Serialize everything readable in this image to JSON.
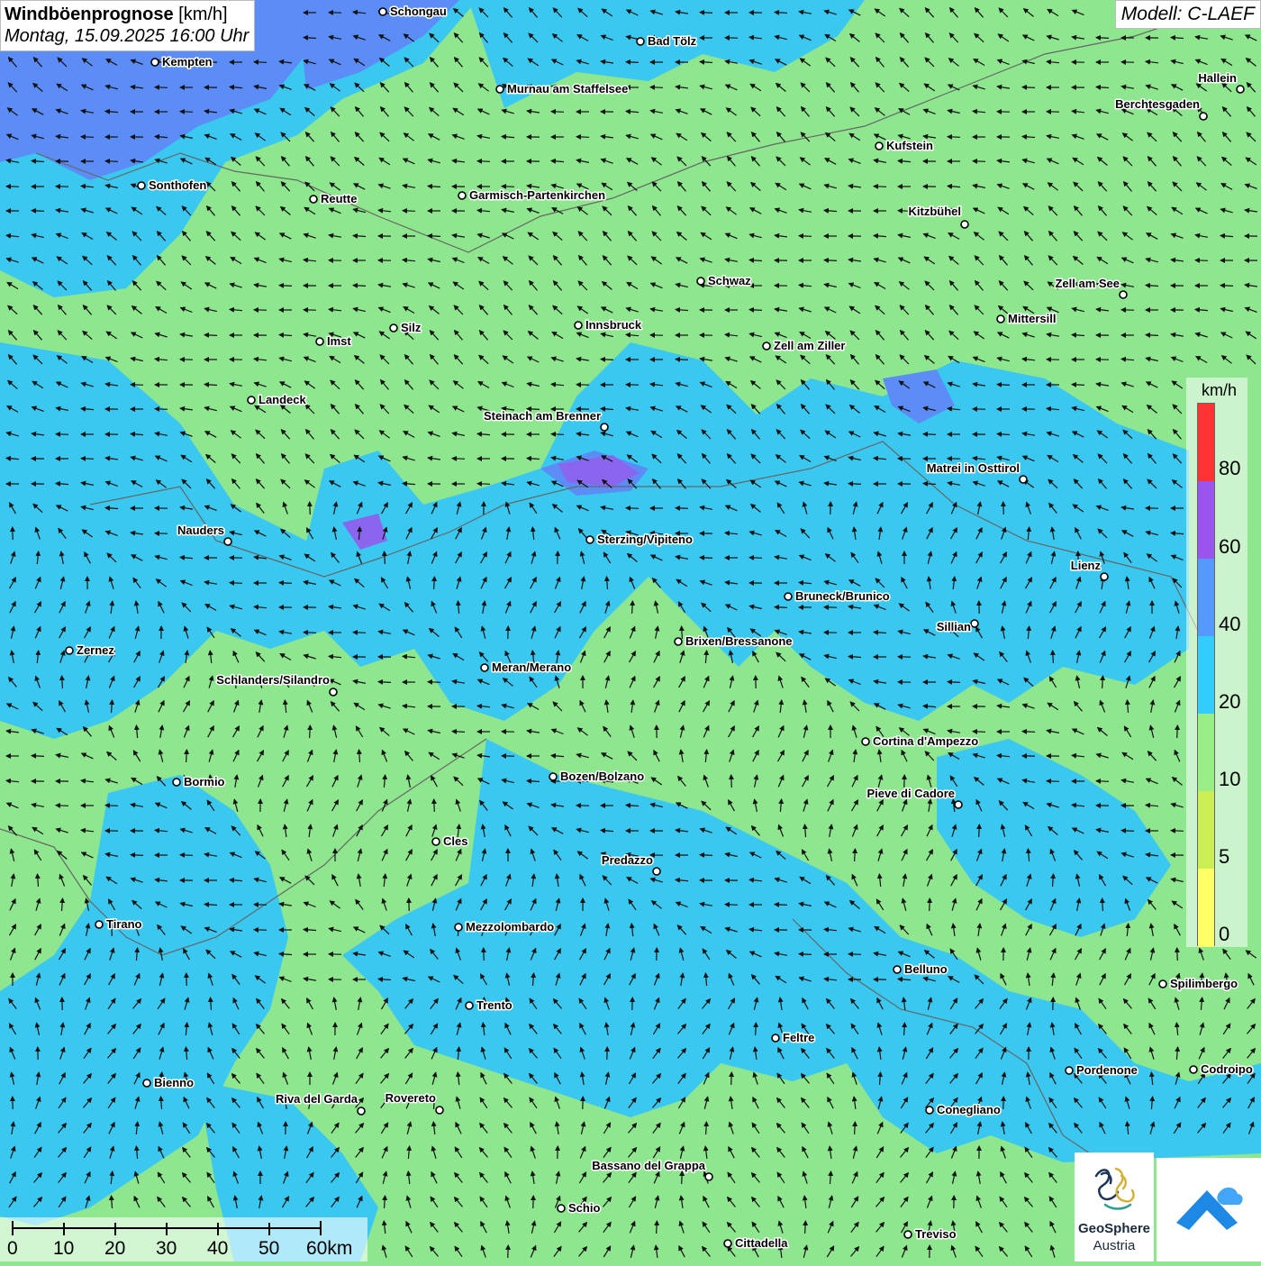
{
  "header": {
    "title": "Windböenprognose",
    "unit": "[km/h]",
    "datetime": "Montag, 15.09.2025 16:00 Uhr",
    "model": "Modell: C-LAEF"
  },
  "legend": {
    "unit": "km/h",
    "ticks": [
      "80",
      "60",
      "40",
      "20",
      "10",
      "5",
      "0"
    ],
    "colors": [
      "#ff3333",
      "#9955ee",
      "#5599ff",
      "#33ccff",
      "#99ee88",
      "#ccee55",
      "#ffff66"
    ]
  },
  "map_colors": {
    "gust_10_20": "#8ee68e",
    "gust_20_40": "#3bc8f0",
    "gust_40_60": "#5c8cf5",
    "gust_60_80": "#8a66ee"
  },
  "scale_bar": {
    "labels": [
      "0",
      "10",
      "20",
      "30",
      "40",
      "50",
      "60km"
    ]
  },
  "cities": [
    {
      "name": "Schongau"
    },
    {
      "name": "Kempten"
    },
    {
      "name": "Bad Tölz"
    },
    {
      "name": "Murnau am Staffelsee"
    },
    {
      "name": "Hallein"
    },
    {
      "name": "Berchtesgaden"
    },
    {
      "name": "Kufstein"
    },
    {
      "name": "Sonthofen"
    },
    {
      "name": "Reutte"
    },
    {
      "name": "Garmisch-Partenkirchen"
    },
    {
      "name": "Kitzbühel"
    },
    {
      "name": "Schwaz"
    },
    {
      "name": "Zell am See"
    },
    {
      "name": "Mittersill"
    },
    {
      "name": "Innsbruck"
    },
    {
      "name": "Imst"
    },
    {
      "name": "Silz"
    },
    {
      "name": "Zell am Ziller"
    },
    {
      "name": "Landeck"
    },
    {
      "name": "Steinach am Brenner"
    },
    {
      "name": "Matrei in Osttirol"
    },
    {
      "name": "Nauders"
    },
    {
      "name": "Sterzing/Vipiteno"
    },
    {
      "name": "Lienz"
    },
    {
      "name": "Bruneck/Brunico"
    },
    {
      "name": "Sillian"
    },
    {
      "name": "Zernez"
    },
    {
      "name": "Brixen/Bressanone"
    },
    {
      "name": "Meran/Merano"
    },
    {
      "name": "Schlanders/Silandro"
    },
    {
      "name": "Cortina d'Ampezzo"
    },
    {
      "name": "Bormio"
    },
    {
      "name": "Bozen/Bolzano"
    },
    {
      "name": "Pieve di Cadore"
    },
    {
      "name": "Cles"
    },
    {
      "name": "Predazzo"
    },
    {
      "name": "Tirano"
    },
    {
      "name": "Mezzolombardo"
    },
    {
      "name": "Belluno"
    },
    {
      "name": "Spilimbergo"
    },
    {
      "name": "Trento"
    },
    {
      "name": "Feltre"
    },
    {
      "name": "Bienno"
    },
    {
      "name": "Pordenone"
    },
    {
      "name": "Codroipo"
    },
    {
      "name": "Riva del Garda"
    },
    {
      "name": "Rovereto"
    },
    {
      "name": "Conegliano"
    },
    {
      "name": "Bassano del Grappa"
    },
    {
      "name": "Schio"
    },
    {
      "name": "Treviso"
    },
    {
      "name": "Cittadella"
    }
  ],
  "logo": {
    "line1": "GeoSphere",
    "line2": "Austria"
  }
}
